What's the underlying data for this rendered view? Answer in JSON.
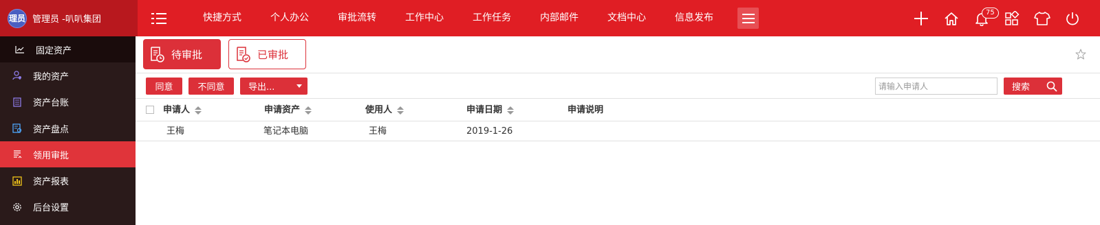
{
  "header": {
    "avatar_text": "理员",
    "brand_text": "管理员 -叭叭集团",
    "nav": [
      "快捷方式",
      "个人办公",
      "审批流转",
      "工作中心",
      "工作任务",
      "内部邮件",
      "文档中心",
      "信息发布"
    ],
    "notification_count": "75",
    "icons": [
      "menu-toggle-icon",
      "hamburger-icon",
      "plus-icon",
      "home-icon",
      "bell-icon",
      "apps-grid-icon",
      "shirt-icon",
      "power-icon"
    ]
  },
  "sidebar": {
    "head": "固定资产",
    "items": [
      {
        "label": "我的资产",
        "icon": "user-asset-icon"
      },
      {
        "label": "资产台账",
        "icon": "ledger-icon"
      },
      {
        "label": "资产盘点",
        "icon": "inventory-icon"
      },
      {
        "label": "领用审批",
        "icon": "approval-icon",
        "active": true
      },
      {
        "label": "资产报表",
        "icon": "report-icon"
      },
      {
        "label": "后台设置",
        "icon": "gear-icon"
      }
    ]
  },
  "tabs": {
    "pending": "待审批",
    "approved": "已审批"
  },
  "toolbar": {
    "agree": "同意",
    "disagree": "不同意",
    "export": "导出...",
    "search_placeholder": "请输入申请人",
    "search": "搜索"
  },
  "table": {
    "columns": [
      "申请人",
      "申请资产",
      "使用人",
      "申请日期",
      "申请说明"
    ],
    "rows": [
      [
        "王梅",
        "笔记本电脑",
        "王梅",
        "2019-1-26",
        ""
      ]
    ]
  },
  "colors": {
    "primary": "#e01e24",
    "button": "#dc3039",
    "sidebar_bg": "#2a1a1a",
    "sidebar_active": "#e0343a"
  }
}
